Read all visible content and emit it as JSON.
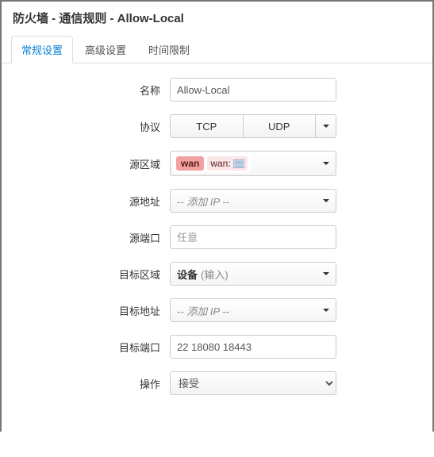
{
  "title": "防火墙 - 通信规则 - Allow-Local",
  "tabs": {
    "general": "常规设置",
    "advanced": "高级设置",
    "time": "时间限制"
  },
  "labels": {
    "name": "名称",
    "protocol": "协议",
    "src_zone": "源区域",
    "src_addr": "源地址",
    "src_port": "源端口",
    "dst_zone": "目标区域",
    "dst_addr": "目标地址",
    "dst_port": "目标端口",
    "action": "操作"
  },
  "values": {
    "name": "Allow-Local",
    "protocol_btn1": "TCP",
    "protocol_btn2": "UDP",
    "src_zone_badge": "wan",
    "src_zone_inner": "wan:",
    "src_addr_placeholder": "-- 添加 IP --",
    "src_port_placeholder": "任意",
    "dst_zone_device": "设备",
    "dst_zone_input": "(输入)",
    "dst_addr_placeholder": "-- 添加 IP --",
    "dst_port": "22 18080 18443",
    "action": "接受"
  }
}
